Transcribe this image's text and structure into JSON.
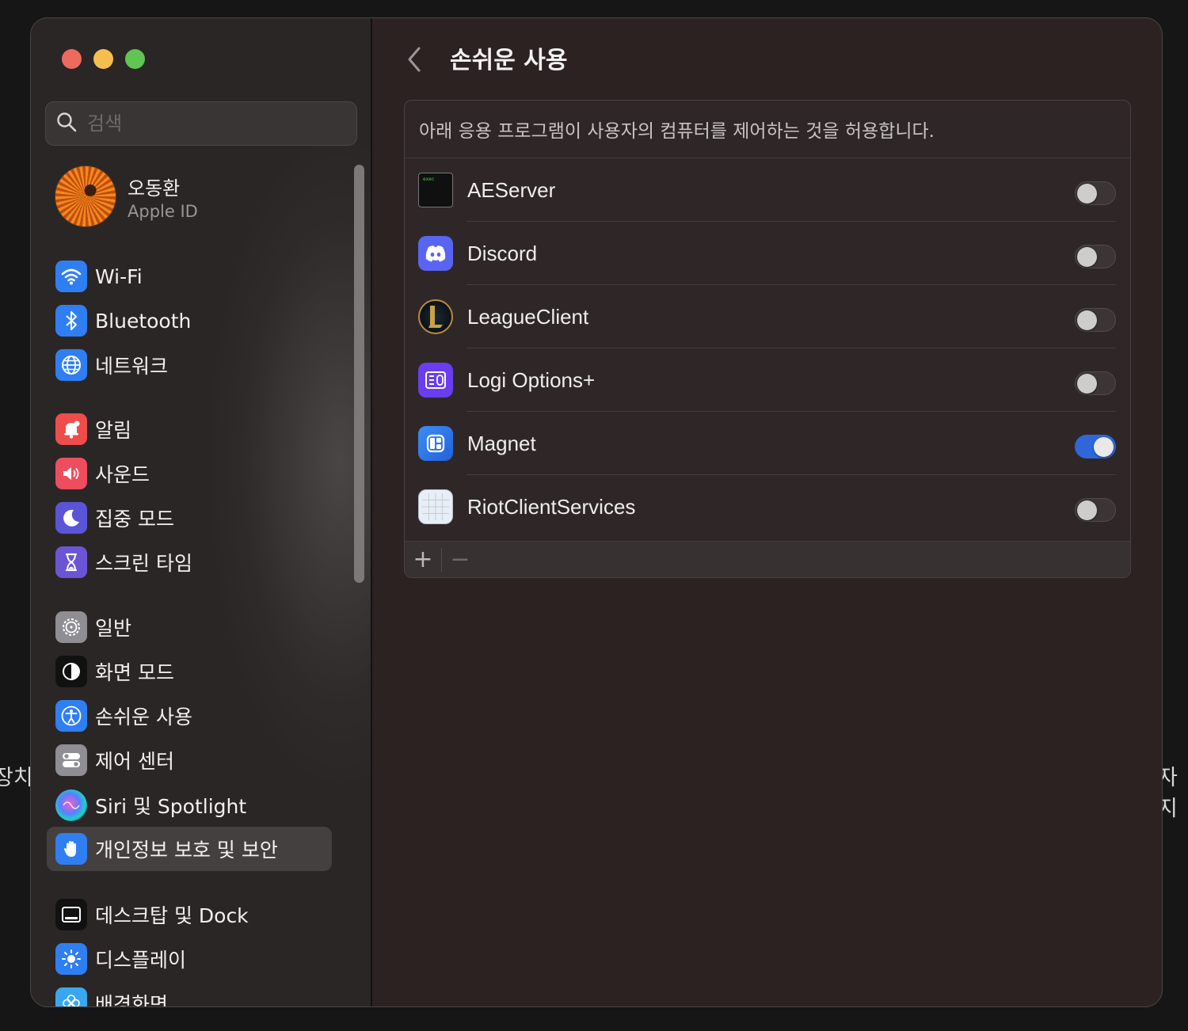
{
  "background": {
    "left_text": "장치",
    "right_text": "자지"
  },
  "sidebar": {
    "search_placeholder": "검색",
    "profile": {
      "name": "오동환",
      "subtitle": "Apple ID"
    },
    "items": [
      {
        "label": "Wi-Fi",
        "icon": "wifi-icon",
        "color": "#2f7ff2"
      },
      {
        "label": "Bluetooth",
        "icon": "bluetooth-icon",
        "color": "#2f7ff2"
      },
      {
        "label": "네트워크",
        "icon": "globe-icon",
        "color": "#2f7ff2"
      },
      {
        "label": "알림",
        "icon": "bell-icon",
        "color": "#ee4d4b"
      },
      {
        "label": "사운드",
        "icon": "speaker-icon",
        "color": "#ee4d5e"
      },
      {
        "label": "집중 모드",
        "icon": "moon-icon",
        "color": "#5a55d6"
      },
      {
        "label": "스크린 타임",
        "icon": "hourglass-icon",
        "color": "#6b55d6"
      },
      {
        "label": "일반",
        "icon": "gear-icon",
        "color": "#8e8e93"
      },
      {
        "label": "화면 모드",
        "icon": "appearance-icon",
        "color": "#111111"
      },
      {
        "label": "손쉬운 사용",
        "icon": "accessibility-icon",
        "color": "#2f7ff2"
      },
      {
        "label": "제어 센터",
        "icon": "switches-icon",
        "color": "#8e8e93"
      },
      {
        "label": "Siri 및 Spotlight",
        "icon": "siri-icon",
        "color": "#222222"
      },
      {
        "label": "개인정보 보호 및 보안",
        "icon": "hand-icon",
        "color": "#2f7ff2"
      },
      {
        "label": "데스크탑 및 Dock",
        "icon": "dock-icon",
        "color": "#111111"
      },
      {
        "label": "디스플레이",
        "icon": "sun-icon",
        "color": "#2f7ff2"
      },
      {
        "label": "배경화면",
        "icon": "flower-icon",
        "color": "#39a7f0"
      }
    ],
    "selected_index": 12
  },
  "main": {
    "title": "손쉬운 사용",
    "description": "아래 응용 프로그램이 사용자의 컴퓨터를 제어하는 것을 허용합니다.",
    "apps": [
      {
        "name": "AEServer",
        "icon": "terminal-exec-icon",
        "enabled": false
      },
      {
        "name": "Discord",
        "icon": "discord-icon",
        "enabled": false
      },
      {
        "name": "LeagueClient",
        "icon": "league-icon",
        "enabled": false
      },
      {
        "name": "Logi Options+",
        "icon": "logi-icon",
        "enabled": false
      },
      {
        "name": "Magnet",
        "icon": "magnet-icon",
        "enabled": true
      },
      {
        "name": "RiotClientServices",
        "icon": "generic-app-icon",
        "enabled": false
      }
    ],
    "footer": {
      "add_label": "+",
      "remove_label": "−"
    }
  },
  "accent_color": "#2f67d8"
}
